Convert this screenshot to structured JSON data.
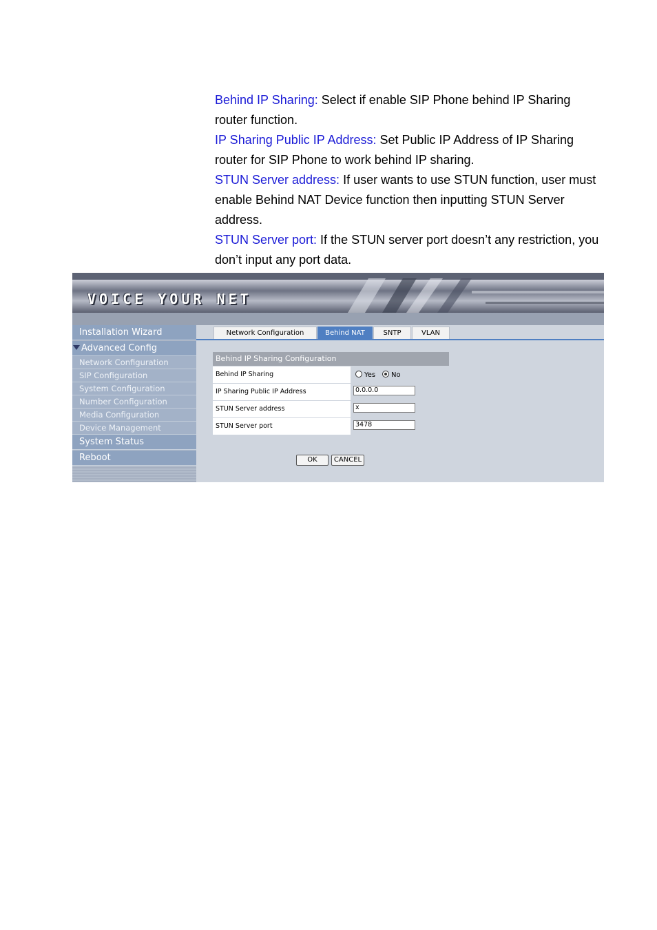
{
  "doc": {
    "paragraphs": [
      {
        "term": "Behind IP Sharing:",
        "text": " Select if enable SIP Phone behind IP Sharing router function."
      },
      {
        "term": "IP Sharing Public IP Address:",
        "text": " Set Public IP Address of IP Sharing router for SIP Phone to work behind IP sharing."
      },
      {
        "term": "STUN Server address:",
        "text": " If user wants to use STUN function, user must enable Behind NAT Device function then inputting STUN Server address."
      },
      {
        "term": "STUN Server port:",
        "text": " If the STUN server port doesn’t any restriction, you don’t input any port data."
      }
    ]
  },
  "banner": {
    "logo_text": "VOICE YOUR NET"
  },
  "sidebar": {
    "installation_wizard": "Installation Wizard",
    "advanced_config": "Advanced Config",
    "sub_items": [
      "Network Configuration",
      "SIP Configuration",
      "System Configuration",
      "Number Configuration",
      "Media Configuration",
      "Device Management"
    ],
    "system_status": "System Status",
    "reboot": "Reboot"
  },
  "tabs": [
    "Network Configuration",
    "Behind NAT",
    "SNTP",
    "VLAN"
  ],
  "active_tab": "Behind NAT",
  "form": {
    "section_title": "Behind IP Sharing Configuration",
    "behind_ip_sharing": {
      "label": "Behind IP Sharing",
      "yes": "Yes",
      "no": "No",
      "selected": "No"
    },
    "public_ip": {
      "label": "IP Sharing Public IP Address",
      "value": "0.0.0.0"
    },
    "stun_address": {
      "label": "STUN Server address",
      "value": "x"
    },
    "stun_port": {
      "label": "STUN Server port",
      "value": "3478"
    },
    "ok_label": "OK",
    "cancel_label": "CANCEL"
  },
  "colors": {
    "term": "#1a1ad6",
    "accent": "#4f7fc2"
  }
}
